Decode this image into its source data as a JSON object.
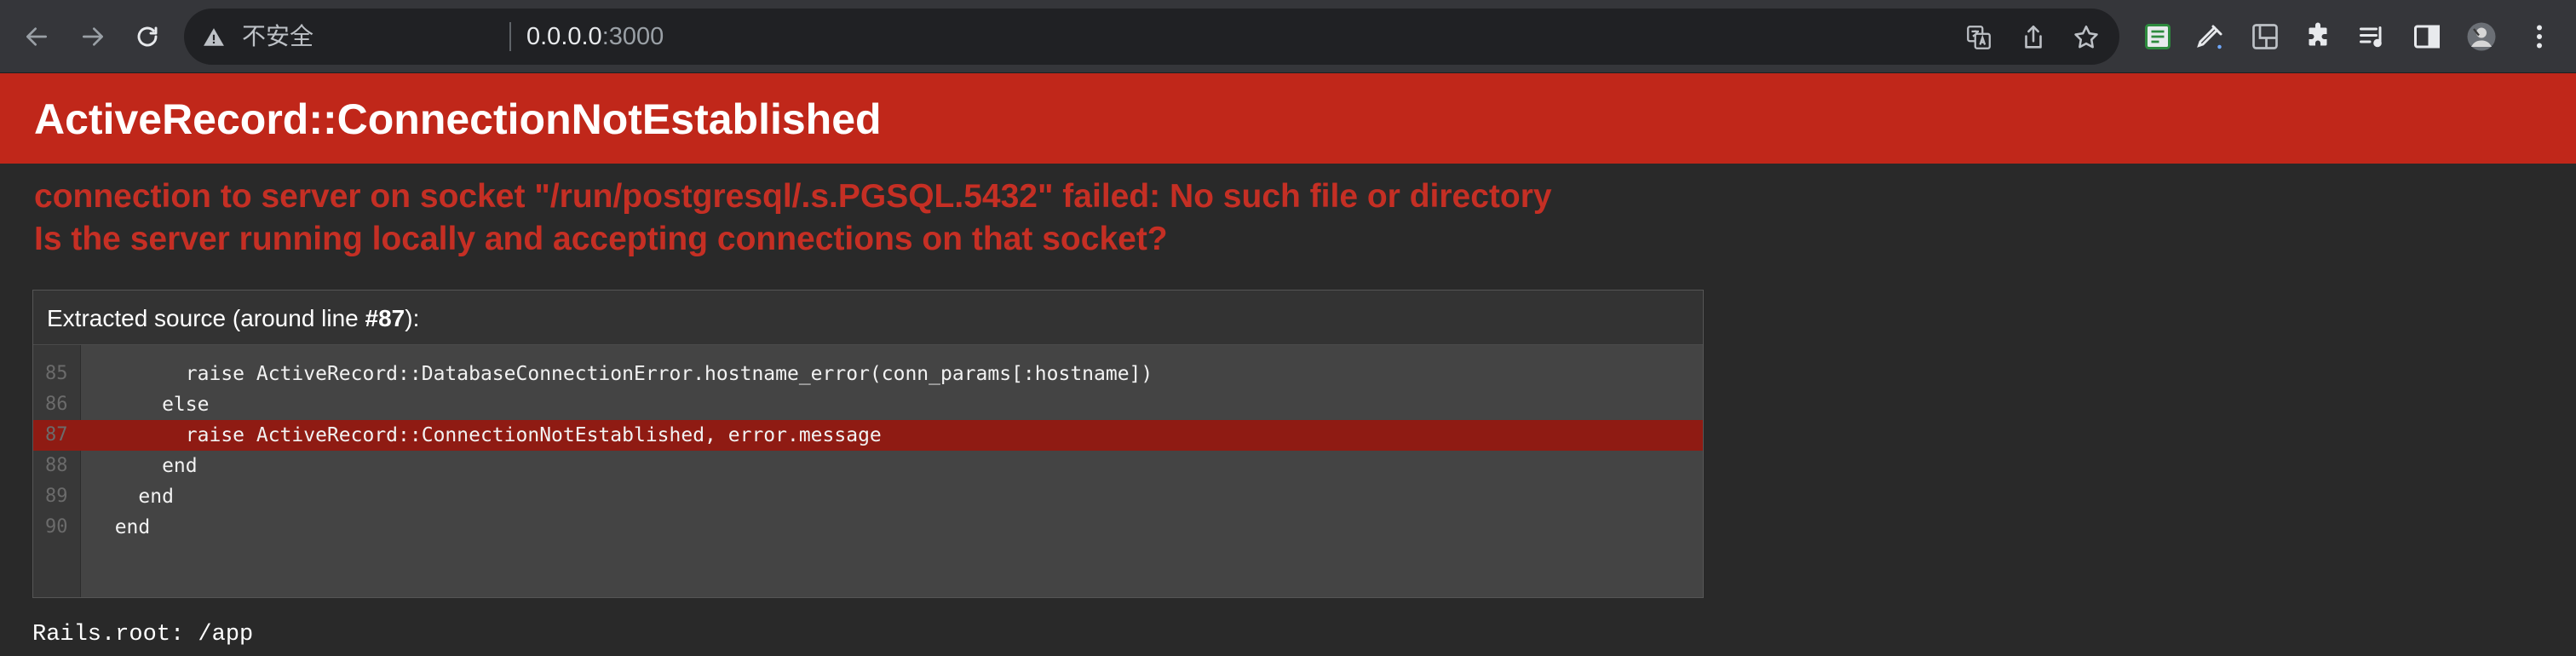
{
  "browser": {
    "security_label": "不安全",
    "url_host": "0.0.0.0",
    "url_port": ":3000"
  },
  "error": {
    "title": "ActiveRecord::ConnectionNotEstablished",
    "message_line1": "connection to server on socket \"/run/postgresql/.s.PGSQL.5432\" failed: No such file or directory",
    "message_line2": "Is the server running locally and accepting connections on that socket?"
  },
  "source": {
    "heading_prefix": "Extracted source (around line ",
    "heading_line": "#87",
    "heading_suffix": "):",
    "lines": [
      {
        "no": "85",
        "code": "        raise ActiveRecord::DatabaseConnectionError.hostname_error(conn_params[:hostname])",
        "highlight": false
      },
      {
        "no": "86",
        "code": "      else",
        "highlight": false
      },
      {
        "no": "87",
        "code": "        raise ActiveRecord::ConnectionNotEstablished, error.message",
        "highlight": true
      },
      {
        "no": "88",
        "code": "      end",
        "highlight": false
      },
      {
        "no": "89",
        "code": "    end",
        "highlight": false
      },
      {
        "no": "90",
        "code": "  end",
        "highlight": false
      }
    ]
  },
  "rails_root": "Rails.root: /app",
  "icons": {
    "back": "back-arrow-icon",
    "forward": "forward-arrow-icon",
    "reload": "reload-icon",
    "warning": "warning-icon",
    "translate": "translate-icon",
    "share": "share-icon",
    "bookmark": "star-icon",
    "extensions": [
      "spreadsheet-extension-icon",
      "eyedropper-icon",
      "screenshot-extension-icon",
      "puzzle-icon",
      "media-queue-icon",
      "side-panel-icon",
      "profile-avatar",
      "kebab-menu-icon"
    ]
  },
  "colors": {
    "header_red": "#c0271a",
    "message_red": "#c52f24",
    "highlight_red": "#8f1b13",
    "page_bg": "#292929"
  }
}
